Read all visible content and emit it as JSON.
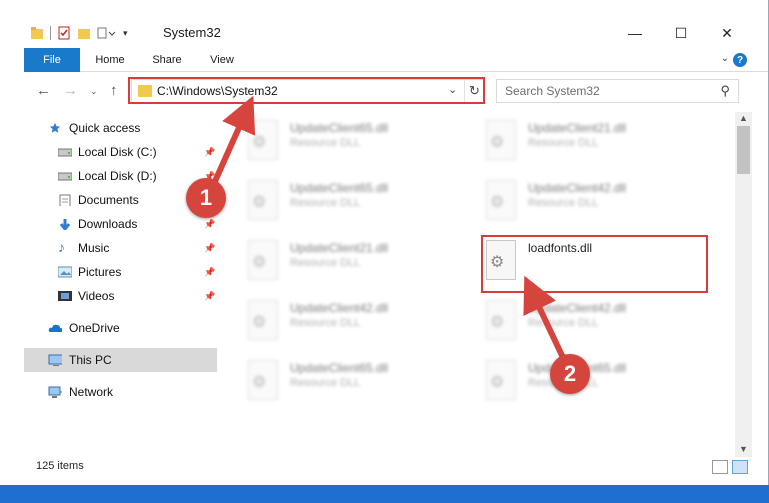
{
  "window": {
    "title": "System32"
  },
  "ribbon": {
    "tabs": [
      "File",
      "Home",
      "Share",
      "View"
    ],
    "help": "?"
  },
  "address": {
    "path": "C:\\Windows\\System32"
  },
  "search": {
    "placeholder": "Search System32"
  },
  "sidebar": {
    "items": [
      {
        "label": "Quick access",
        "pinned": false
      },
      {
        "label": "Local Disk (C:)",
        "pinned": true
      },
      {
        "label": "Local Disk (D:)",
        "pinned": true
      },
      {
        "label": "Documents",
        "pinned": true
      },
      {
        "label": "Downloads",
        "pinned": true
      },
      {
        "label": "Music",
        "pinned": true
      },
      {
        "label": "Pictures",
        "pinned": true
      },
      {
        "label": "Videos",
        "pinned": true
      },
      {
        "label": "OneDrive",
        "pinned": false
      },
      {
        "label": "This PC",
        "pinned": false,
        "selected": true
      },
      {
        "label": "Network",
        "pinned": false
      }
    ]
  },
  "files": [
    {
      "name": "UpdateClient65.dll",
      "type": "Resource DLL"
    },
    {
      "name": "UpdateClient21.dll",
      "type": "Resource DLL"
    },
    {
      "name": "UpdateClient65.dll",
      "type": "Resource DLL"
    },
    {
      "name": "UpdateClient42.dll",
      "type": "Resource DLL"
    },
    {
      "name": "UpdateClient21.dll",
      "type": "Resource DLL"
    },
    {
      "name": "loadfonts.dll",
      "type": ""
    },
    {
      "name": "UpdateClient42.dll",
      "type": "Resource DLL"
    },
    {
      "name": "UpdateClient42.dll",
      "type": "Resource DLL"
    },
    {
      "name": "UpdateClient65.dll",
      "type": "Resource DLL"
    },
    {
      "name": "UpdateClient65.dll",
      "type": "Resource DLL"
    }
  ],
  "status": {
    "count": "125 items"
  },
  "annotations": {
    "step1": "1",
    "step2": "2"
  },
  "colors": {
    "accent": "#1979ca",
    "highlight": "#d83b3b",
    "folder": "#f2c94c"
  }
}
